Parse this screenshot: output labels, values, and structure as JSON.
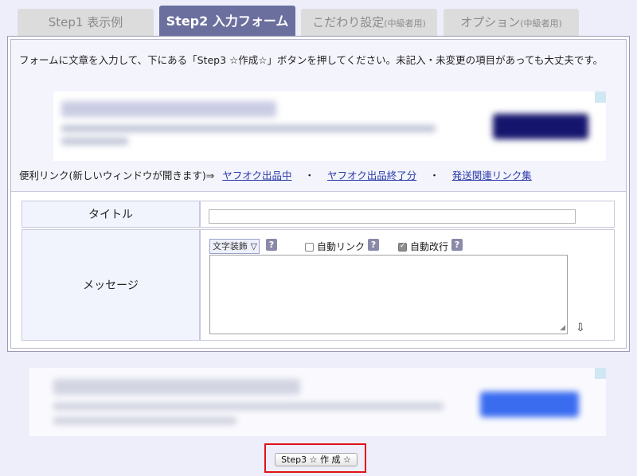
{
  "tabs": [
    {
      "label": "Step1 表示例",
      "suffix": ""
    },
    {
      "label": "Step2 入力フォーム",
      "suffix": ""
    },
    {
      "label": "こだわり設定",
      "suffix": "(中級者用)"
    },
    {
      "label": "オプション",
      "suffix": "(中級者用)"
    }
  ],
  "active_tab": 1,
  "intro": {
    "text": "フォームに文章を入力して、下にある「Step3 ☆作成☆」ボタンを押してください。未記入・未変更の項目があっても大丈夫です。"
  },
  "links": {
    "prefix": "便利リンク(新しいウィンドウが開きます)⇒",
    "items": [
      "ヤフオク出品中",
      "ヤフオク出品終了分",
      "発送関連リンク集"
    ],
    "separator": "・"
  },
  "form": {
    "title_label": "タイトル",
    "title_value": "",
    "message_label": "メッセージ",
    "message_value": "",
    "deco_select": "文字装飾 ▽",
    "help_glyph": "?",
    "auto_link_label": "自動リンク",
    "auto_link_checked": false,
    "auto_break_label": "自動改行",
    "auto_break_checked": true
  },
  "icons": {
    "resize": "resize-grip-icon",
    "down": "arrow-down-icon",
    "help": "help-icon"
  },
  "submit": {
    "label": "Step3 ☆ 作 成 ☆"
  },
  "colors": {
    "active_tab": "#6b6f9e",
    "inactive_tab": "#dcdcdc",
    "link": "#2a3aa8",
    "highlight_frame": "#e0101a",
    "page_bg": "#eeeefb"
  }
}
